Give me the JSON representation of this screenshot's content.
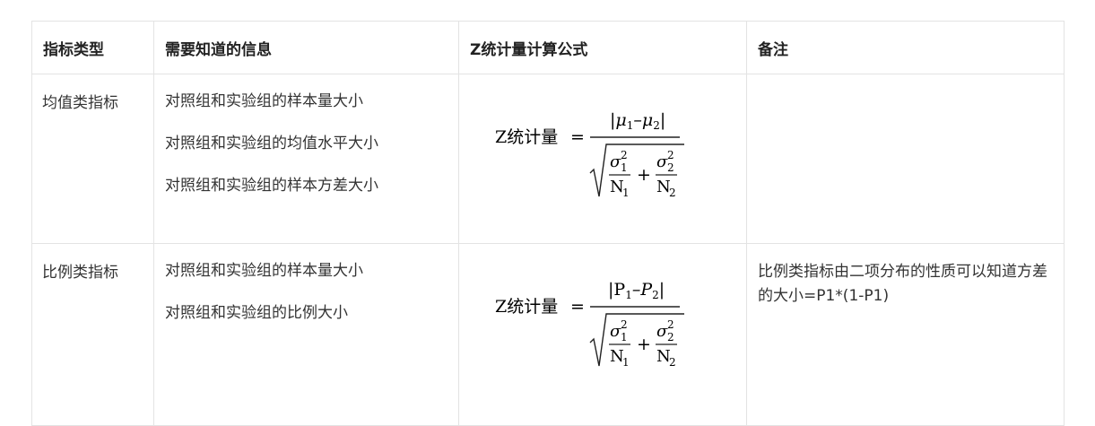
{
  "table": {
    "headers": [
      "指标类型",
      "需要知道的信息",
      "Z统计量计算公式",
      "备注"
    ],
    "rows": [
      {
        "type": "均值类指标",
        "info": [
          "对照组和实验组的样本量大小",
          "对照组和实验组的均值水平大小",
          "对照组和实验组的样本方差大小"
        ],
        "formula": {
          "lhs": "Z统计量",
          "numerator_open": "|μ",
          "numerator_sub1": "1",
          "numerator_sep": "–μ",
          "numerator_sub2": "2",
          "numerator_close": "|",
          "den1_sigma": "σ",
          "den1_sup": "2",
          "den1_sub": "1",
          "den1_n": "N",
          "den1_nsub": "1",
          "den2_sigma": "σ",
          "den2_sup": "2",
          "den2_sub": "2",
          "den2_n": "N",
          "den2_nsub": "2"
        },
        "note": ""
      },
      {
        "type": "比例类指标",
        "info": [
          "对照组和实验组的样本量大小",
          "对照组和实验组的比例大小"
        ],
        "formula": {
          "lhs": "Z统计量",
          "numerator_open": "|P",
          "numerator_sub1": "1",
          "numerator_sep": "–P",
          "numerator_sub2": "2",
          "numerator_close": "|",
          "den1_sigma": "σ",
          "den1_sup": "2",
          "den1_sub": "1",
          "den1_n": "N",
          "den1_nsub": "1",
          "den2_sigma": "σ",
          "den2_sup": "2",
          "den2_sub": "2",
          "den2_n": "N",
          "den2_nsub": "2"
        },
        "note": "比例类指标由二项分布的性质可以知道方差的大小=P1*(1-P1)"
      }
    ]
  }
}
